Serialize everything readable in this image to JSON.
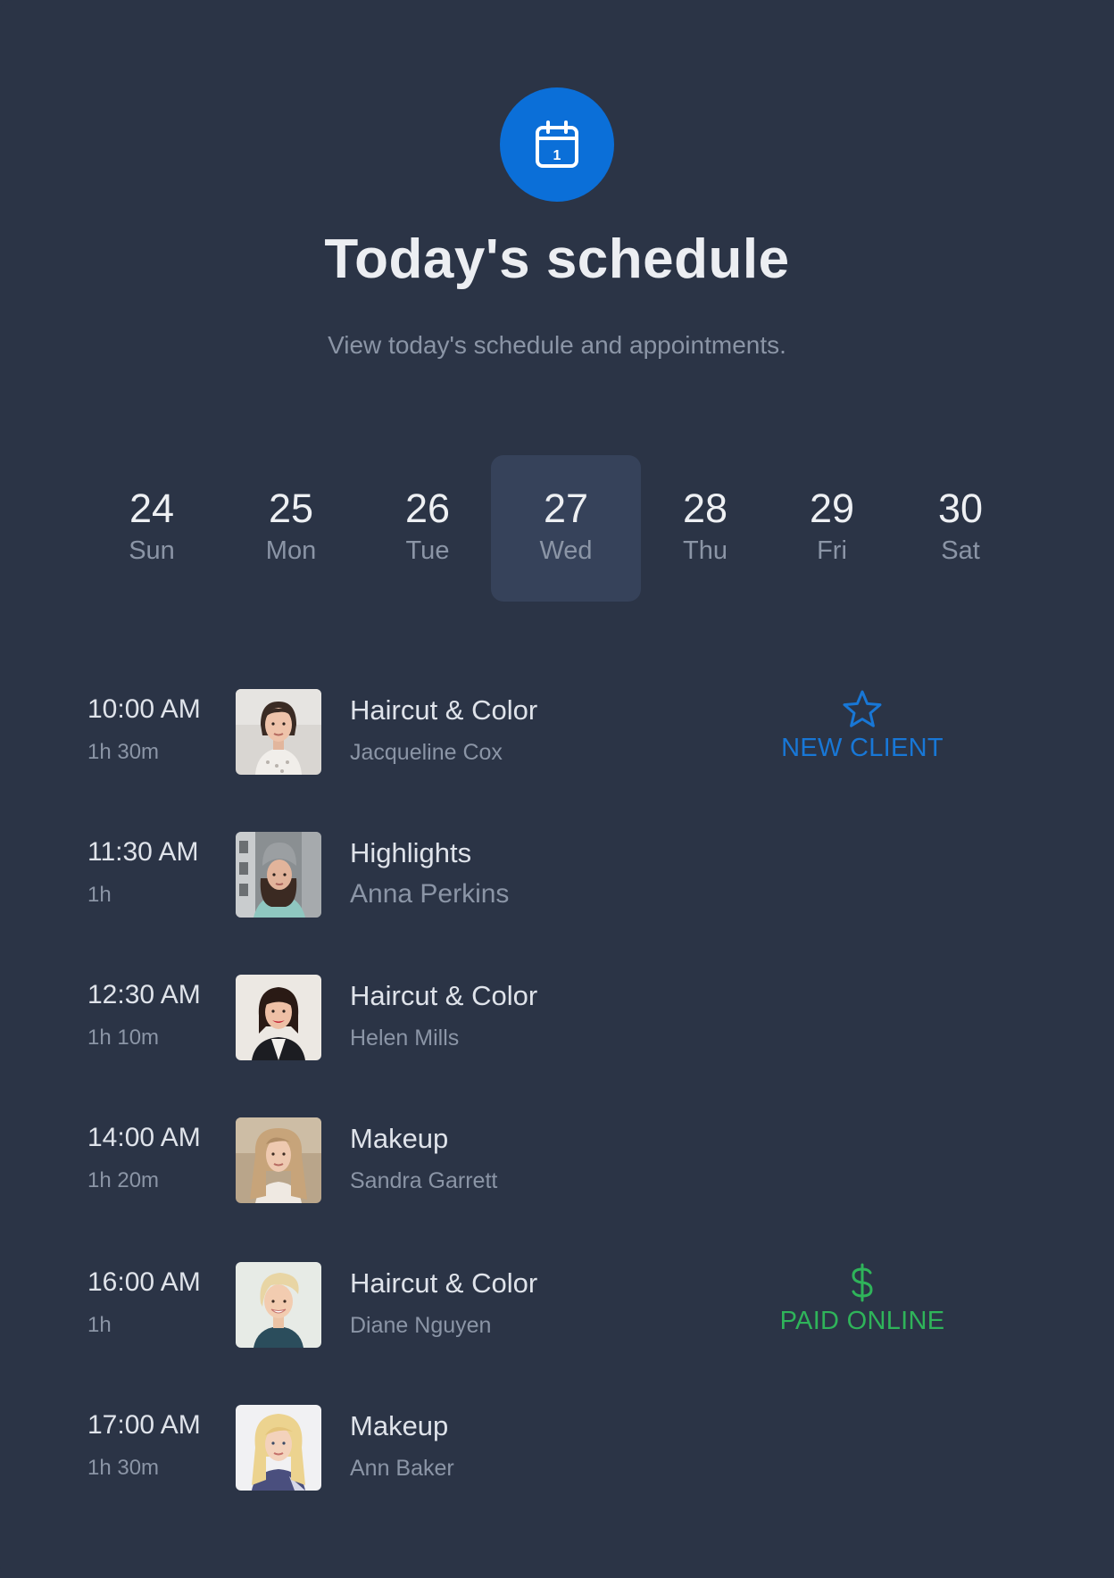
{
  "header": {
    "icon": "calendar-icon",
    "icon_day": "1",
    "title": "Today's schedule",
    "subtitle": "View today's schedule and appointments."
  },
  "colors": {
    "background": "#2b3446",
    "accent_blue": "#0b6fd8",
    "selected_day_bg": "#36425a",
    "new_client": "#1877d6",
    "paid_online": "#2fb45a"
  },
  "days": [
    {
      "num": "24",
      "name": "Sun",
      "selected": false
    },
    {
      "num": "25",
      "name": "Mon",
      "selected": false
    },
    {
      "num": "26",
      "name": "Tue",
      "selected": false
    },
    {
      "num": "27",
      "name": "Wed",
      "selected": true
    },
    {
      "num": "28",
      "name": "Thu",
      "selected": false
    },
    {
      "num": "29",
      "name": "Fri",
      "selected": false
    },
    {
      "num": "30",
      "name": "Sat",
      "selected": false
    }
  ],
  "appointments": [
    {
      "time": "10:00 AM",
      "duration": "1h 30m",
      "service": "Haircut & Color",
      "client": "Jacqueline Cox",
      "tag": {
        "label": "NEW CLIENT",
        "icon": "star-icon",
        "color": "#1877d6"
      }
    },
    {
      "time": "11:30 AM",
      "duration": "1h",
      "service": "Highlights",
      "client": "Anna Perkins"
    },
    {
      "time": "12:30 AM",
      "duration": "1h 10m",
      "service": "Haircut & Color",
      "client": "Helen Mills"
    },
    {
      "time": "14:00 AM",
      "duration": "1h 20m",
      "service": "Makeup",
      "client": "Sandra Garrett"
    },
    {
      "time": "16:00 AM",
      "duration": "1h",
      "service": "Haircut & Color",
      "client": "Diane Nguyen",
      "tag": {
        "label": "PAID ONLINE",
        "icon": "dollar-icon",
        "color": "#2fb45a"
      }
    },
    {
      "time": "17:00 AM",
      "duration": "1h 30m",
      "service": "Makeup",
      "client": "Ann Baker"
    }
  ]
}
